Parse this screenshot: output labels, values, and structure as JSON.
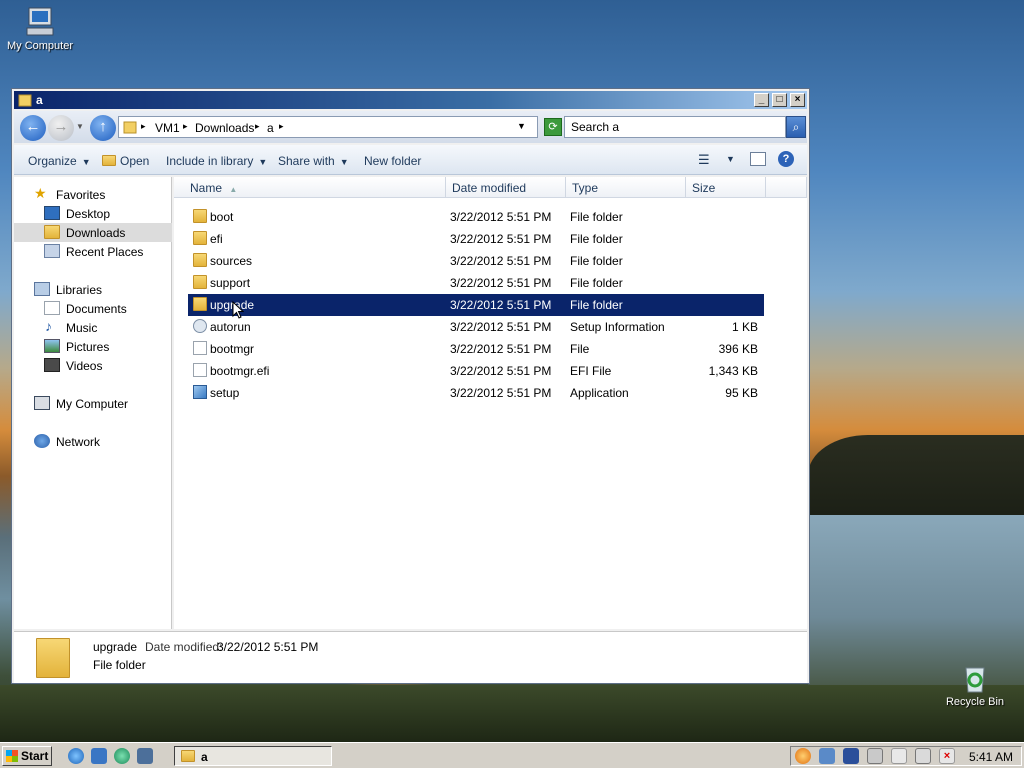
{
  "desktop": {
    "icons": [
      {
        "label": "My Computer"
      },
      {
        "label": "Recycle Bin"
      }
    ]
  },
  "window": {
    "title": "a",
    "controls": {
      "minimize": "_",
      "maximize": "□",
      "close": "×"
    }
  },
  "address": {
    "crumbs": [
      "VM1",
      "Downloads",
      "a"
    ],
    "search_placeholder": "Search a"
  },
  "toolbar": {
    "organize": "Organize",
    "open": "Open",
    "include_in_library": "Include in library",
    "share_with": "Share with",
    "new_folder": "New folder"
  },
  "navpane": {
    "favorites": "Favorites",
    "desktop": "Desktop",
    "downloads": "Downloads",
    "recent_places": "Recent Places",
    "libraries": "Libraries",
    "documents": "Documents",
    "music": "Music",
    "pictures": "Pictures",
    "videos": "Videos",
    "my_computer": "My Computer",
    "network": "Network"
  },
  "filelist": {
    "columns": {
      "name": "Name",
      "date": "Date modified",
      "type": "Type",
      "size": "Size"
    },
    "rows": [
      {
        "name": "boot",
        "date": "3/22/2012 5:51 PM",
        "type": "File folder",
        "size": ""
      },
      {
        "name": "efi",
        "date": "3/22/2012 5:51 PM",
        "type": "File folder",
        "size": ""
      },
      {
        "name": "sources",
        "date": "3/22/2012 5:51 PM",
        "type": "File folder",
        "size": ""
      },
      {
        "name": "support",
        "date": "3/22/2012 5:51 PM",
        "type": "File folder",
        "size": ""
      },
      {
        "name": "upgrade",
        "date": "3/22/2012 5:51 PM",
        "type": "File folder",
        "size": ""
      },
      {
        "name": "autorun",
        "date": "3/22/2012 5:51 PM",
        "type": "Setup Information",
        "size": "1 KB"
      },
      {
        "name": "bootmgr",
        "date": "3/22/2012 5:51 PM",
        "type": "File",
        "size": "396 KB"
      },
      {
        "name": "bootmgr.efi",
        "date": "3/22/2012 5:51 PM",
        "type": "EFI File",
        "size": "1,343 KB"
      },
      {
        "name": "setup",
        "date": "3/22/2012 5:51 PM",
        "type": "Application",
        "size": "95 KB"
      }
    ]
  },
  "details": {
    "name": "upgrade",
    "date_label": "Date modified:",
    "date_value": "3/22/2012 5:51 PM",
    "type": "File folder"
  },
  "taskbar": {
    "start": "Start",
    "task_label": "a",
    "clock": "5:41 AM"
  }
}
